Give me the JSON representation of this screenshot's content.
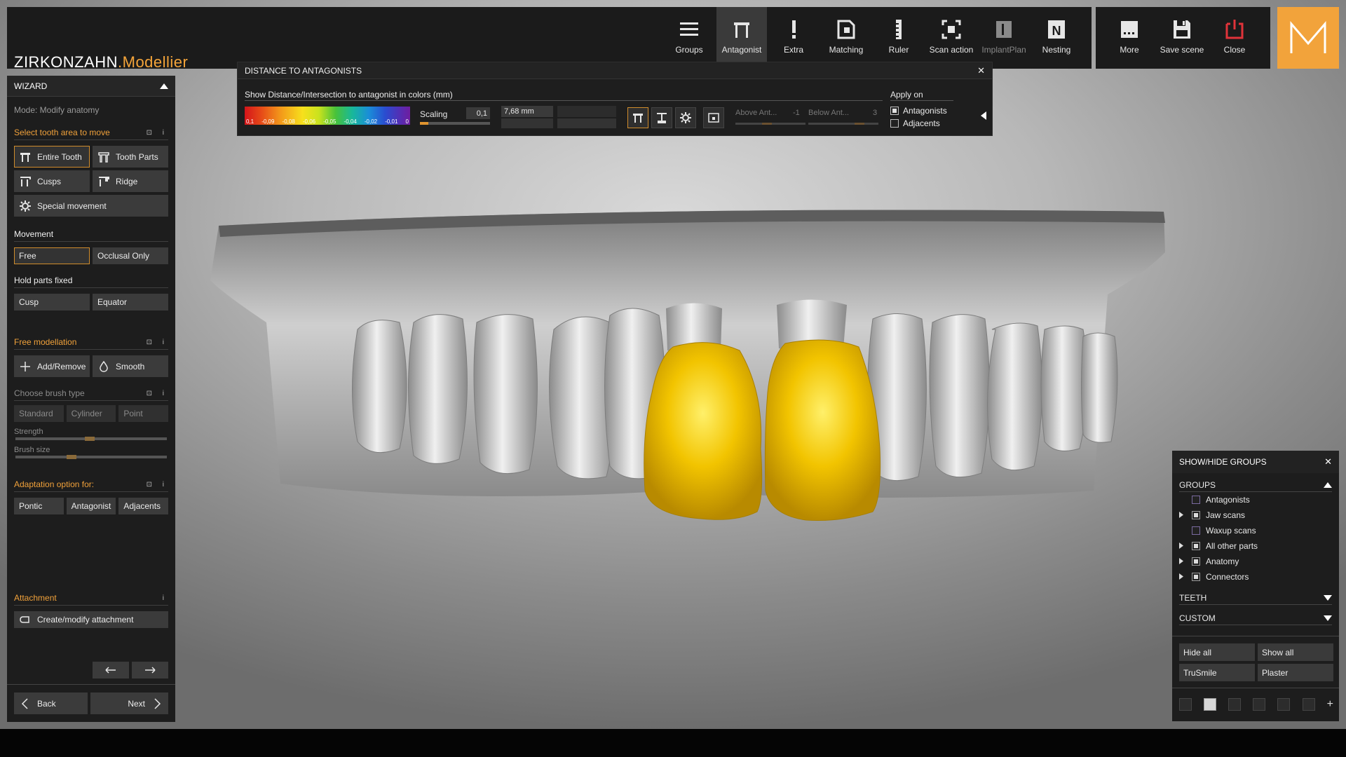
{
  "app": {
    "brand_a": "ZIRKONZAHN",
    "brand_b": ".Modellier",
    "m_logo": "M"
  },
  "toolbar": {
    "buttons": [
      {
        "label": "Groups",
        "icon": "menu-icon"
      },
      {
        "label": "Antagonist",
        "icon": "antagonist-icon"
      },
      {
        "label": "Extra",
        "icon": "exclamation-icon"
      },
      {
        "label": "Matching",
        "icon": "matching-icon"
      },
      {
        "label": "Ruler",
        "icon": "ruler-icon"
      },
      {
        "label": "Scan action",
        "icon": "scan-icon"
      },
      {
        "label": "ImplantPlan",
        "icon": "implant-icon"
      },
      {
        "label": "Nesting",
        "icon": "nesting-icon"
      }
    ],
    "right_buttons": [
      {
        "label": "More",
        "icon": "more-icon"
      },
      {
        "label": "Save scene",
        "icon": "save-icon"
      },
      {
        "label": "Close",
        "icon": "power-icon"
      }
    ],
    "nesting_letter": "N"
  },
  "wizard": {
    "title": "WIZARD",
    "mode": "Mode: Modify anatomy",
    "select_title": "Select tooth area to move",
    "pin_icons": "⊡ i",
    "info_icon": "i",
    "entire_tooth": "Entire Tooth",
    "tooth_parts": "Tooth Parts",
    "cusps": "Cusps",
    "ridge": "Ridge",
    "special_movement": "Special movement",
    "movement_title": "Movement",
    "free": "Free",
    "occlusal_only": "Occlusal Only",
    "hold_title": "Hold parts fixed",
    "cusp": "Cusp",
    "equator": "Equator",
    "free_mod_title": "Free modellation",
    "add_remove": "Add/Remove",
    "smooth": "Smooth",
    "brush_title": "Choose brush type",
    "standard": "Standard",
    "cylinder": "Cylinder",
    "point": "Point",
    "strength": "Strength",
    "brush_size": "Brush size",
    "strength_value": 0.46,
    "brush_size_value": 0.34,
    "adapt_title": "Adaptation option for:",
    "pontic": "Pontic",
    "antagonist": "Antagonist",
    "adjacents": "Adjacents",
    "attachment_title": "Attachment",
    "create_attachment": "Create/modify attachment",
    "back": "Back",
    "next": "Next"
  },
  "distance_panel": {
    "title": "DISTANCE TO ANTAGONISTS",
    "close_glyph": "✕",
    "subtitle": "Show Distance/Intersection to antagonist in colors (mm)",
    "colorbar_ticks": [
      "0,1",
      "-0,09",
      "-0,08",
      "-0,06",
      "-0,05",
      "-0,04",
      "-0,02",
      "-0,01",
      "0"
    ],
    "scaling_label": "Scaling",
    "scaling_value": "0,1",
    "scaling_fill": 0.12,
    "distance_value": "7,68 mm",
    "above_label": "Above Ant...",
    "above_value": "-1",
    "below_label": "Below Ant...",
    "below_value": "3",
    "apply_on": "Apply on",
    "antagonists": "Antagonists",
    "adjacents": "Adjacents",
    "antagonists_checked": true,
    "adjacents_checked": false
  },
  "groups_panel": {
    "title": "SHOW/HIDE GROUPS",
    "close_glyph": "✕",
    "groups_label": "GROUPS",
    "items": [
      {
        "label": "Antagonists",
        "expand": false,
        "checked": false
      },
      {
        "label": "Jaw scans",
        "expand": true,
        "checked": true
      },
      {
        "label": "Waxup scans",
        "expand": false,
        "checked": false
      },
      {
        "label": "All other parts",
        "expand": true,
        "checked": true
      },
      {
        "label": "Anatomy",
        "expand": true,
        "checked": true
      },
      {
        "label": "Connectors",
        "expand": true,
        "checked": true
      }
    ],
    "teeth_label": "TEETH",
    "custom_label": "CUSTOM",
    "hide_all": "Hide all",
    "show_all": "Show all",
    "trusmile": "TruSmile",
    "plaster": "Plaster",
    "plus_glyph": "+"
  },
  "colors": {
    "accent": "#f0a13a",
    "crown": "#e7b800"
  }
}
